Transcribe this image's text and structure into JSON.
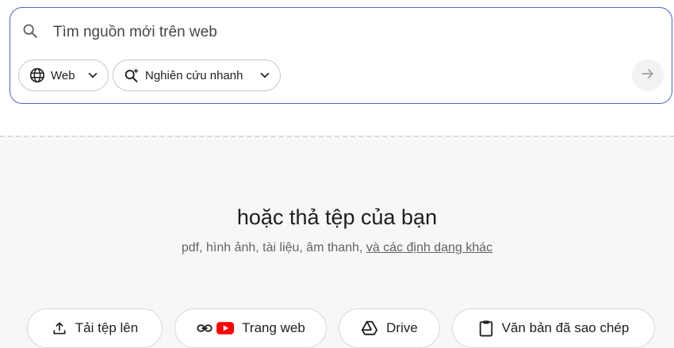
{
  "search": {
    "placeholder": "Tìm nguồn mới trên web",
    "value": ""
  },
  "chips": {
    "source": {
      "label": "Web",
      "icon": "globe-icon"
    },
    "mode": {
      "label": "Nghiên cứu nhanh",
      "icon": "search-spark-icon"
    }
  },
  "submit": {
    "icon": "arrow-right-icon"
  },
  "drop": {
    "title": "hoặc thả tệp của bạn",
    "subtitle_prefix": "pdf, hình ảnh, tài liệu, âm thanh,",
    "subtitle_link": "và các định dạng khác"
  },
  "sources": {
    "upload": {
      "label": "Tải tệp lên",
      "icon": "upload-icon"
    },
    "website": {
      "label": "Trang web",
      "icons": [
        "link-icon",
        "youtube-icon"
      ]
    },
    "drive": {
      "label": "Drive",
      "icon": "drive-icon"
    },
    "paste": {
      "label": "Văn bản đã sao chép",
      "icon": "clipboard-icon"
    }
  },
  "colors": {
    "accent_border": "#4d63c9",
    "youtube_red": "#ff0000",
    "drop_background": "#f7f7f7"
  }
}
